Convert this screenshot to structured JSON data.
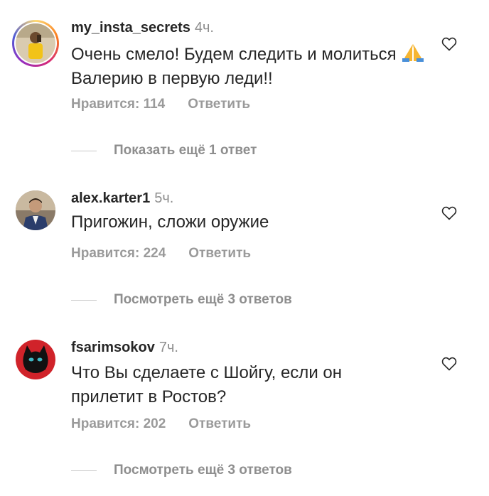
{
  "comments": [
    {
      "username": "my_insta_secrets",
      "time": "4ч.",
      "text_part1": "Очень смело! Будем следить и молиться",
      "emoji": "pray-emoji",
      "text_part2": "Валерию в первую леди!!",
      "likes_label": "Нравится: 114",
      "reply_label": "Ответить",
      "more_replies": "Показать ещё 1 ответ",
      "has_story_ring": true
    },
    {
      "username": "alex.karter1",
      "time": "5ч.",
      "text": "Пригожин, сложи оружие",
      "likes_label": "Нравится: 224",
      "reply_label": "Ответить",
      "more_replies": "Посмотреть ещё 3 ответов"
    },
    {
      "username": "fsarimsokov",
      "time": "7ч.",
      "text": "Что Вы сделаете с Шойгу, если он прилетит в Ростов?",
      "likes_label": "Нравится: 202",
      "reply_label": "Ответить",
      "more_replies": "Посмотреть ещё 3 ответов"
    }
  ],
  "icons": {
    "like": "heart-outline-icon"
  },
  "colors": {
    "text": "#262626",
    "secondary": "#8e8e8e",
    "background": "#ffffff"
  }
}
